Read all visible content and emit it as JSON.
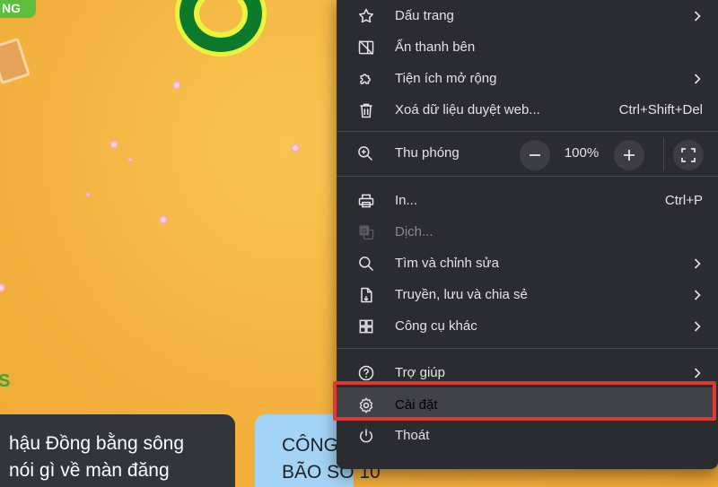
{
  "background_page": {
    "logo_text": "NG",
    "side_text": "S",
    "news_cards": [
      {
        "lines": [
          "hậu Đồng bằng sông",
          "nói gì về màn đăng"
        ]
      },
      {
        "lines": [
          "CÔNG",
          "BÃO SỐ 10"
        ]
      }
    ]
  },
  "menu": {
    "items": [
      {
        "id": "bookmarks",
        "icon": "star-icon",
        "label": "Dấu trang",
        "has_submenu": true
      },
      {
        "id": "hide-sidebar",
        "icon": "sidebar-hide-icon",
        "label": "Ẩn thanh bên"
      },
      {
        "id": "extensions",
        "icon": "puzzle-icon",
        "label": "Tiện ích mở rộng",
        "has_submenu": true
      },
      {
        "id": "clear-data",
        "icon": "trash-icon",
        "label": "Xoá dữ liệu duyệt web...",
        "shortcut": "Ctrl+Shift+Del"
      },
      {
        "id": "print",
        "icon": "printer-icon",
        "label": "In...",
        "shortcut": "Ctrl+P"
      },
      {
        "id": "translate",
        "icon": "translate-icon",
        "label": "Dịch...",
        "disabled": true
      },
      {
        "id": "find-edit",
        "icon": "search-icon",
        "label": "Tìm và chỉnh sửa",
        "has_submenu": true
      },
      {
        "id": "cast-save-share",
        "icon": "save-share-icon",
        "label": "Truyền, lưu và chia sẻ",
        "has_submenu": true
      },
      {
        "id": "more-tools",
        "icon": "grid-icon",
        "label": "Công cụ khác",
        "has_submenu": true
      },
      {
        "id": "help",
        "icon": "help-icon",
        "label": "Trợ giúp",
        "has_submenu": true
      },
      {
        "id": "settings",
        "icon": "gear-icon",
        "label": "Cài đặt",
        "highlighted": true
      },
      {
        "id": "exit",
        "icon": "power-icon",
        "label": "Thoát"
      }
    ],
    "zoom": {
      "label": "Thu phóng",
      "value": "100%",
      "minus": "−",
      "plus": "+"
    }
  },
  "colors": {
    "menu_bg": "#2b2c2f",
    "highlight_border": "#e03737",
    "page_bg": "#f4b43c"
  }
}
